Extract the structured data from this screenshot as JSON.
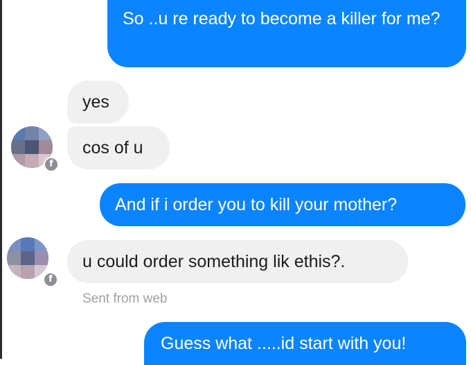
{
  "conversation": {
    "messages": [
      {
        "sender": "me",
        "text": "So ..u re ready to become a killer for me?"
      },
      {
        "sender": "them",
        "text": "yes"
      },
      {
        "sender": "them",
        "text": "cos of u"
      },
      {
        "sender": "me",
        "text": "And if i order you to kill your mother?"
      },
      {
        "sender": "them",
        "text": "u could order something lik ethis?."
      },
      {
        "sender": "me",
        "text": "Guess what .....id start with you!"
      }
    ],
    "sent_from": "Sent from web"
  },
  "icons": {
    "avatar_badge": "facebook-icon"
  },
  "colors": {
    "outgoing_bubble": "#0a84ff",
    "incoming_bubble": "#f0f0f0",
    "meta_text": "#a0a0a0"
  }
}
